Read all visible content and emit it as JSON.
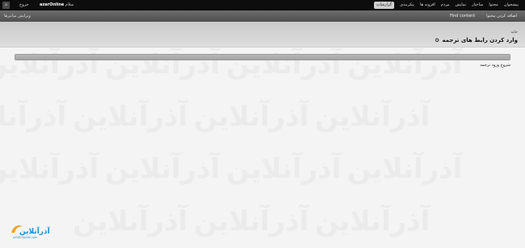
{
  "toolbar": {
    "home_icon": "home-icon",
    "logout": "خروج",
    "greeting_prefix": "سلام",
    "username": "azarOnline",
    "menu": [
      "پیشخوان",
      "محتوا",
      "ساختار",
      "نمایش",
      "مردم",
      "افزونه ها",
      "پیکربندی",
      "گزارشات"
    ],
    "active_menu_index": 7
  },
  "shortcuts": {
    "edit_label": "ویرایش میانبرها",
    "items": [
      "Find content",
      "اضافه کردن محتوا"
    ]
  },
  "page": {
    "breadcrumb": "خانه",
    "title": "وارد کردن رابط های ترجمه",
    "title_icon": "star-icon"
  },
  "progress": {
    "percent": 100,
    "label": "شروع ورود ترجمه"
  },
  "watermark": {
    "text": "آذرآنلاین"
  },
  "logo": {
    "text": "آذرآنلاین",
    "subtext": "AZARONLINE.com"
  },
  "colors": {
    "toolbar": "#0d0d0d",
    "shortcut_bar": "#5a5a5a",
    "logo_accent": "#f0a21e",
    "logo_text": "#1e8fcf"
  }
}
